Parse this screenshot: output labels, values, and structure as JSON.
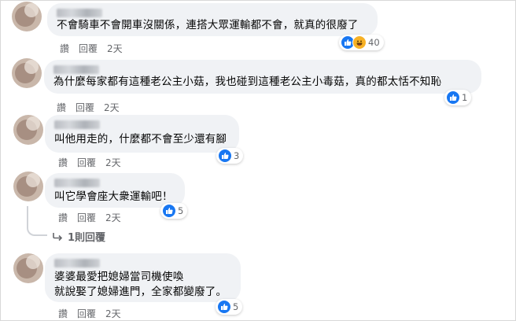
{
  "comments": [
    {
      "text_lines": [
        "不會騎車不會開車沒關係，連搭大眾運輸都不會，就真的很廢了"
      ],
      "actions": {
        "like": "讚",
        "reply": "回覆",
        "time": "2天"
      },
      "reactions": {
        "icons": [
          "like-icon",
          "haha-icon"
        ],
        "count": "40"
      }
    },
    {
      "text_lines": [
        "為什麼每家都有這種老公主小菇，我也碰到這種老公主小毒菇，真的都太恬不知恥"
      ],
      "actions": {
        "like": "讚",
        "reply": "回覆",
        "time": "2天"
      },
      "reactions": {
        "icons": [
          "like-icon"
        ],
        "count": "1"
      }
    },
    {
      "text_lines": [
        "叫他用走的，什麼都不會至少還有腳"
      ],
      "actions": {
        "like": "讚",
        "reply": "回覆",
        "time": "2天"
      },
      "reactions": {
        "icons": [
          "like-icon"
        ],
        "count": "3"
      }
    },
    {
      "text_lines": [
        "叫它學會座大衆運輸吧！"
      ],
      "actions": {
        "like": "讚",
        "reply": "回覆",
        "time": "2天"
      },
      "reactions": {
        "icons": [
          "like-icon"
        ],
        "count": "5"
      },
      "replies_link": "1則回覆"
    },
    {
      "text_lines": [
        "婆婆最愛把媳婦當司機使喚",
        "就說娶了媳婦進門，全家都變廢了。"
      ],
      "actions": {
        "like": "讚",
        "reply": "回覆",
        "time": "2天"
      },
      "reactions": {
        "icons": [
          "like-icon"
        ],
        "count": "5"
      }
    }
  ],
  "colors": {
    "bubble": "#f0f2f5",
    "like_blue": "#1877f2",
    "haha_yellow": "#f7b125",
    "meta_gray": "#65676b"
  }
}
